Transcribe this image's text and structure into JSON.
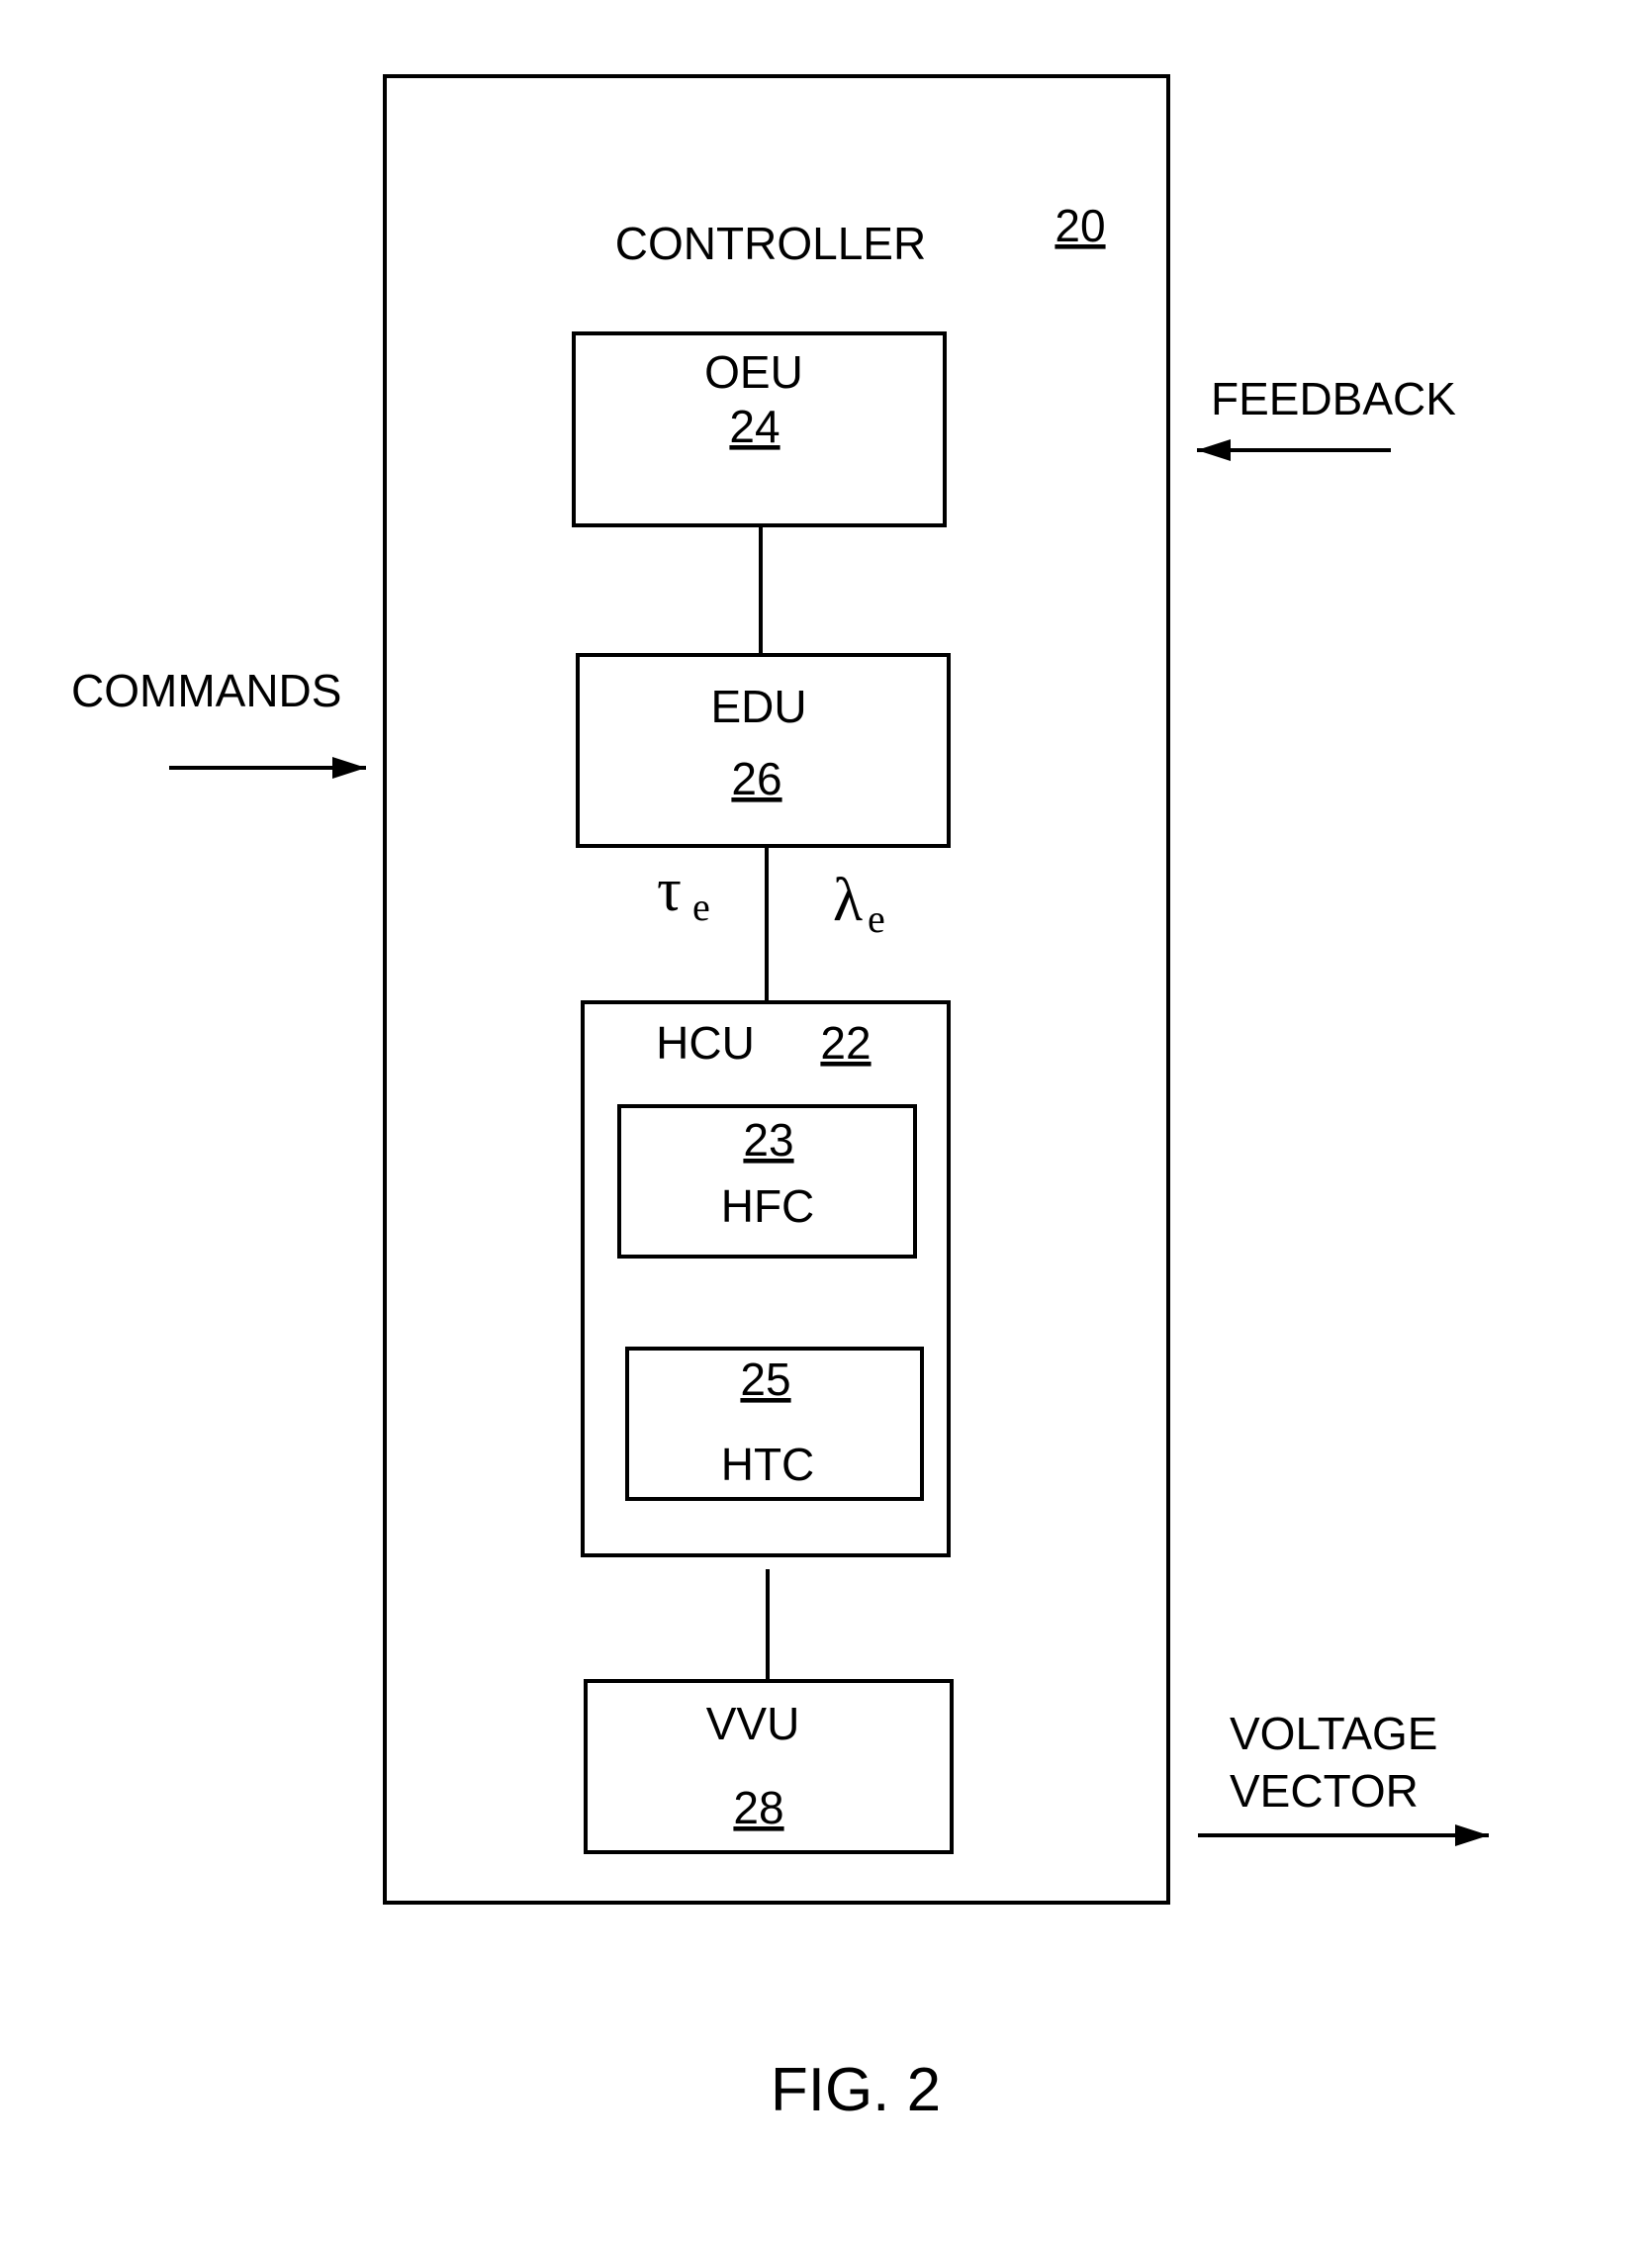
{
  "figure": {
    "caption": "FIG. 2",
    "colors": {
      "stroke": "#000000",
      "background": "#ffffff"
    }
  },
  "controller": {
    "label": "CONTROLLER",
    "ref": "20"
  },
  "blocks": {
    "oeu": {
      "label": "OEU",
      "ref": "24"
    },
    "edu": {
      "label": "EDU",
      "ref": "26"
    },
    "hcu": {
      "label": "HCU",
      "ref": "22"
    },
    "hfc": {
      "label": "HFC",
      "ref": "23"
    },
    "htc": {
      "label": "HTC",
      "ref": "25"
    },
    "vvu": {
      "label": "VVU",
      "ref": "28"
    }
  },
  "signals": {
    "tau": {
      "symbol": "τ",
      "sub": "e"
    },
    "lambda": {
      "symbol": "λ",
      "sub": "e"
    }
  },
  "external": {
    "commands": "COMMANDS",
    "feedback": "FEEDBACK",
    "voltage_vector_line1": "VOLTAGE",
    "voltage_vector_line2": "VECTOR"
  }
}
